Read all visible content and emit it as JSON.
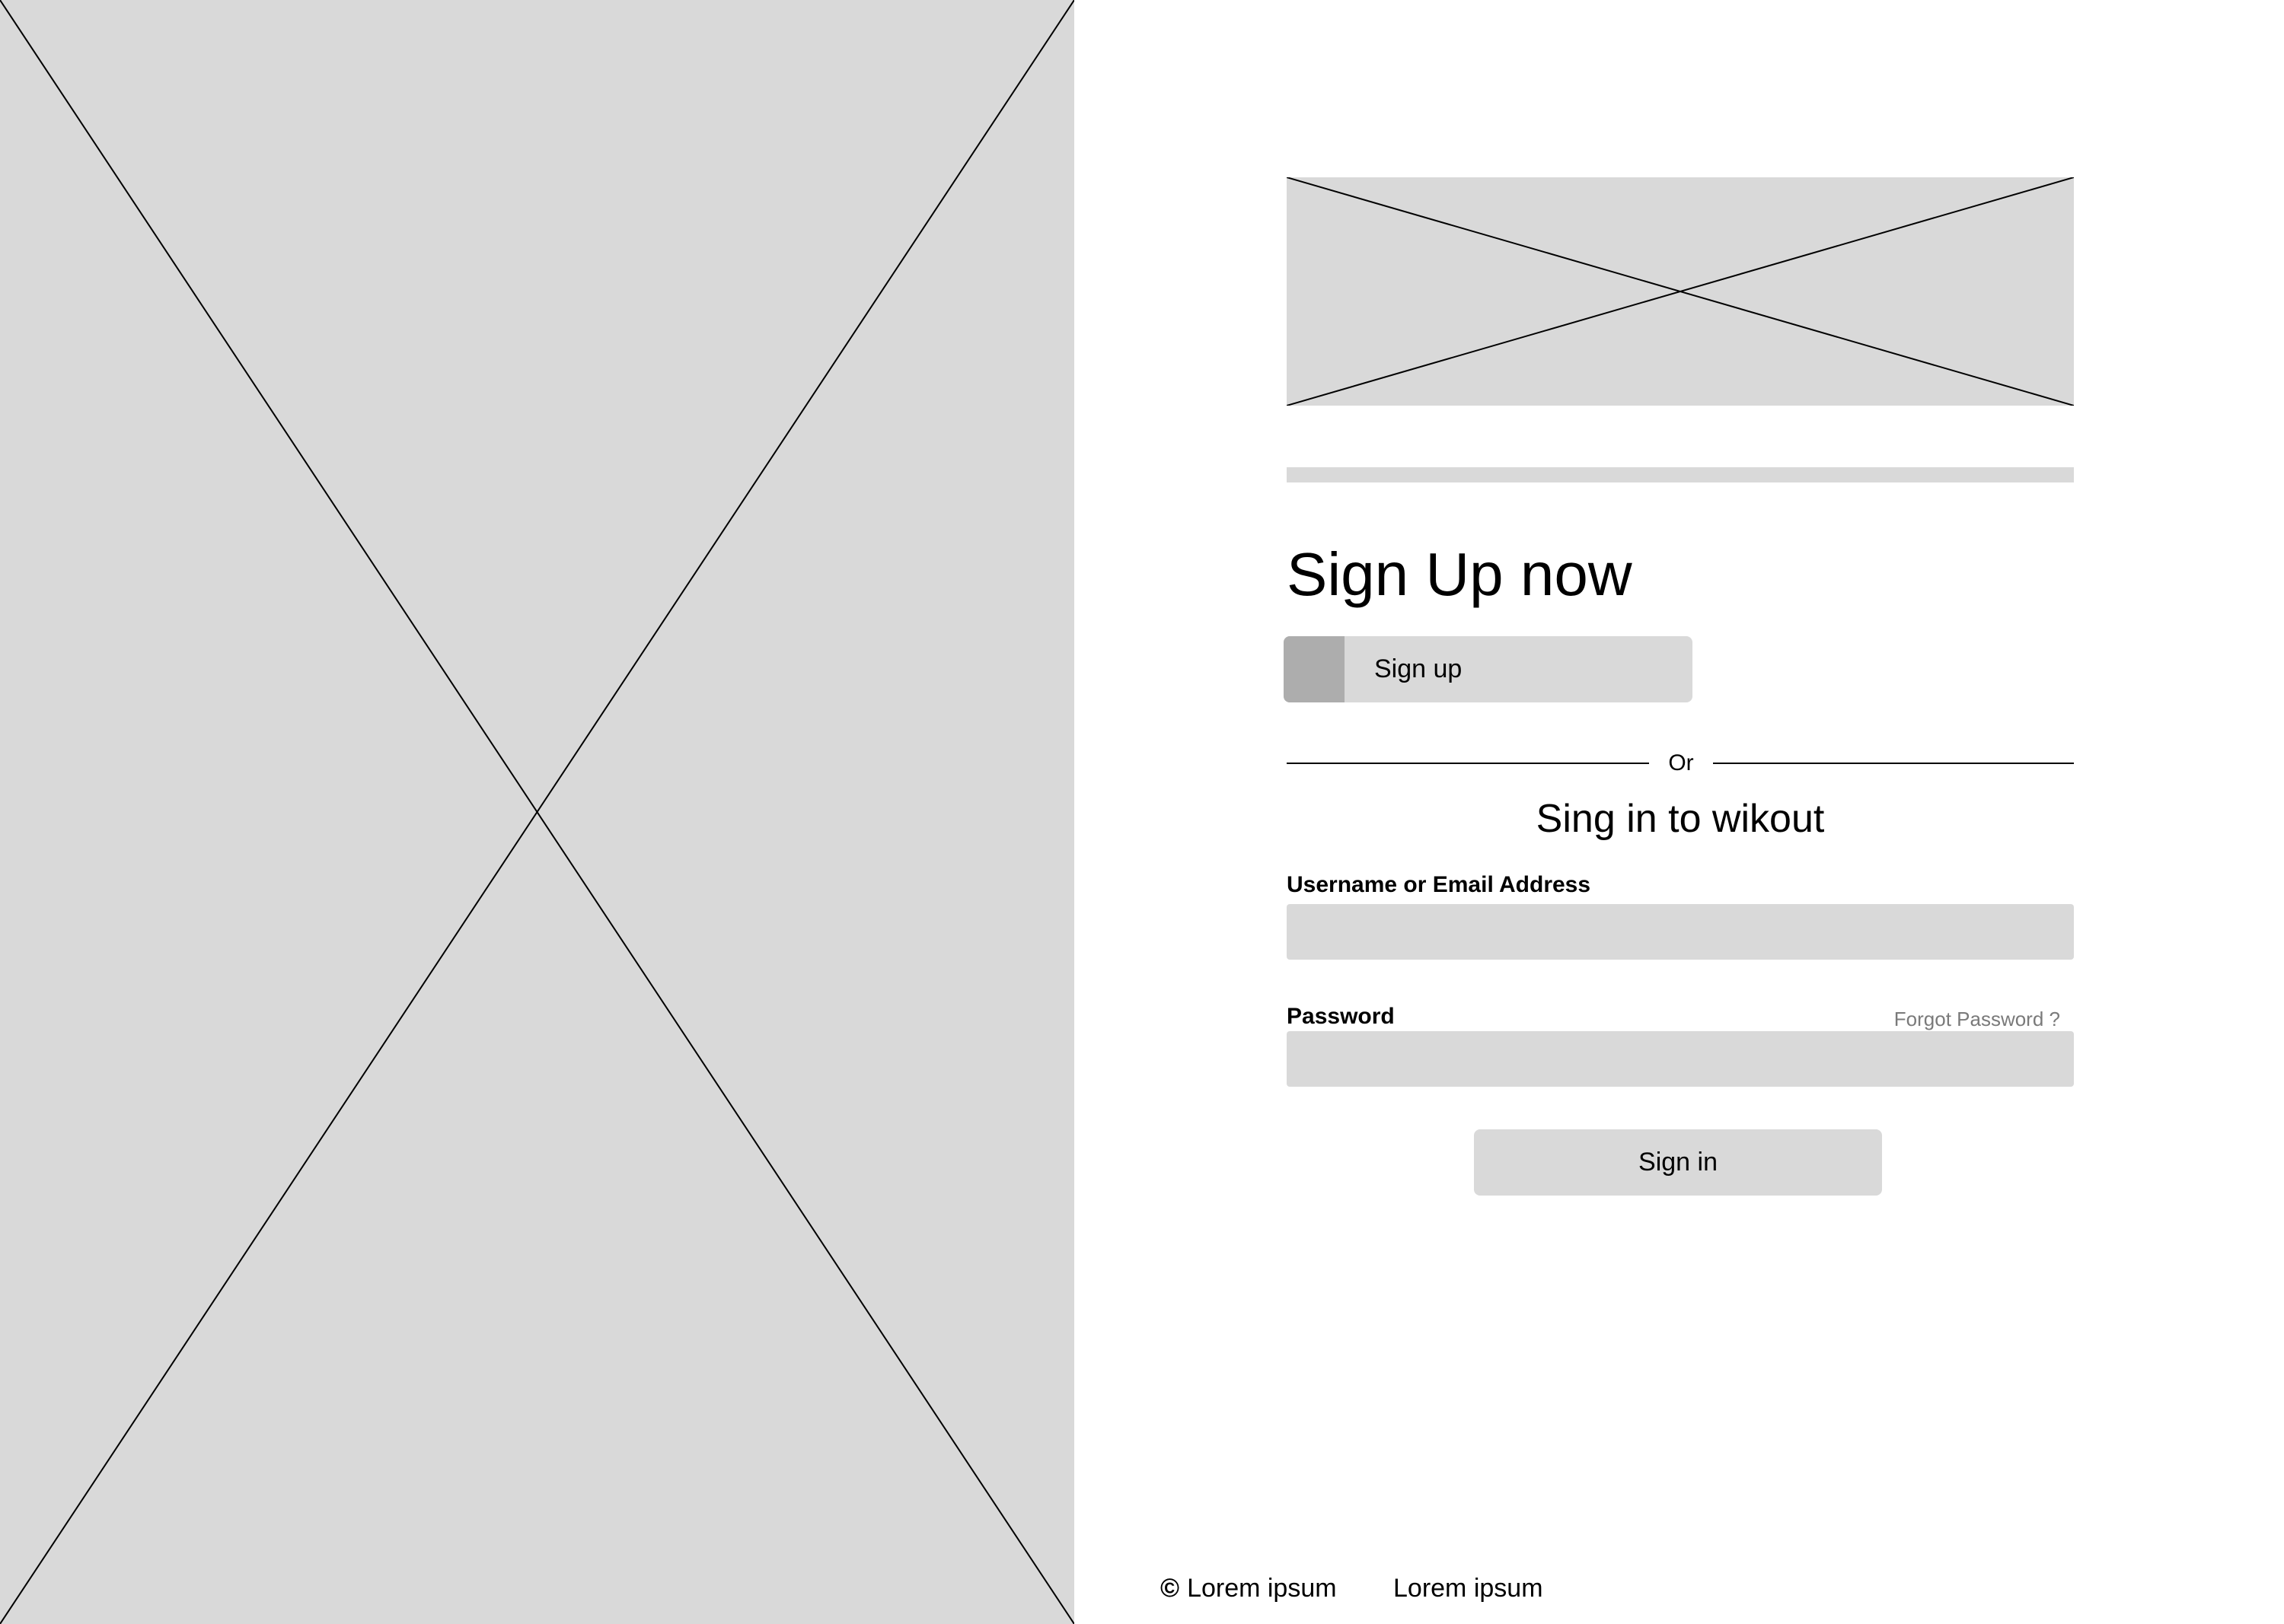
{
  "hero": {
    "icon": "image-placeholder-icon"
  },
  "logo": {
    "icon": "image-placeholder-icon"
  },
  "heading": "Sign Up now",
  "signup_button": {
    "label": "Sign up"
  },
  "divider": {
    "text": "Or"
  },
  "signin_title": "Sing in to wikout",
  "form": {
    "username_label": "Username or Email Address",
    "username_value": "",
    "password_label": "Password",
    "password_value": "",
    "forgot_password": "Forgot Password ?",
    "submit_label": "Sign in"
  },
  "footer": {
    "copyright_symbol": "©",
    "copyright_text": "Lorem ipsum",
    "link_text": "Lorem ipsum"
  },
  "colors": {
    "placeholder_gray": "#d9d9d9",
    "accent_gray": "#adadad",
    "muted_text": "#7a7a7a",
    "text": "#000000",
    "background": "#ffffff"
  }
}
